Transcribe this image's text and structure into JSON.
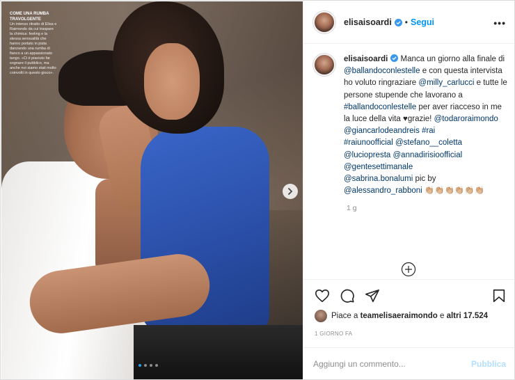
{
  "post": {
    "photo_caption_title": "COME UNA RUMBA TRAVOLGENTE",
    "photo_caption_body": "Un intenso ritratto di Elisa e Raimondo da cui traspare la chimica: feeling e la stessa sensualità che hanno portato in pista danzando una rumba di fianco a un appassionato tango. «Ci è piaciuto far sognare il pubblico, ma anche noi siamo stati molto coinvolti in questo gioco»."
  },
  "header": {
    "username": "elisaisoardi",
    "separator": "•",
    "follow_label": "Segui",
    "more_label": "•••"
  },
  "caption": {
    "username": "elisaisoardi",
    "t1": " Manca un giorno alla finale di ",
    "m1": "@ballandoconlestelle",
    "t2": " e con questa intervista ho voluto ringraziare ",
    "m2": "@milly_carlucci",
    "t3": " e tutte le persone stupende che lavorano a ",
    "m3": "#ballandoconlestelle",
    "t4": " per aver riacceso in me la luce della vita ♥grazie! ",
    "m4": "@todaroraimondo",
    "m5": "@giancarlodeandreis",
    "m6": "#rai",
    "m7": "#raiunoofficial",
    "m8": "@stefano__coletta",
    "m9": "@luciopresta",
    "m10": "@annadirisioofficial",
    "m11": "@gentesettimanale",
    "m12": "@sabrina.bonalumi",
    "t5": " pic by ",
    "m13": "@alessandro_rabboni",
    "t6": " 👏🏼👏🏼👏🏼👏🏼👏🏼👏🏼",
    "age": "1 g"
  },
  "likes": {
    "prefix": "Piace a ",
    "user": "teamelisaeraimondo",
    "middle": " e ",
    "count": "altri 17.524"
  },
  "date": "1 GIORNO FA",
  "comment": {
    "placeholder": "Aggiungi un commento...",
    "publish_label": "Pubblica"
  },
  "colors": {
    "link_blue": "#0095f6",
    "mention_dark": "#00376b",
    "publish_disabled": "#b2dffc"
  },
  "carousel": {
    "slides": 4,
    "active_index": 0
  }
}
